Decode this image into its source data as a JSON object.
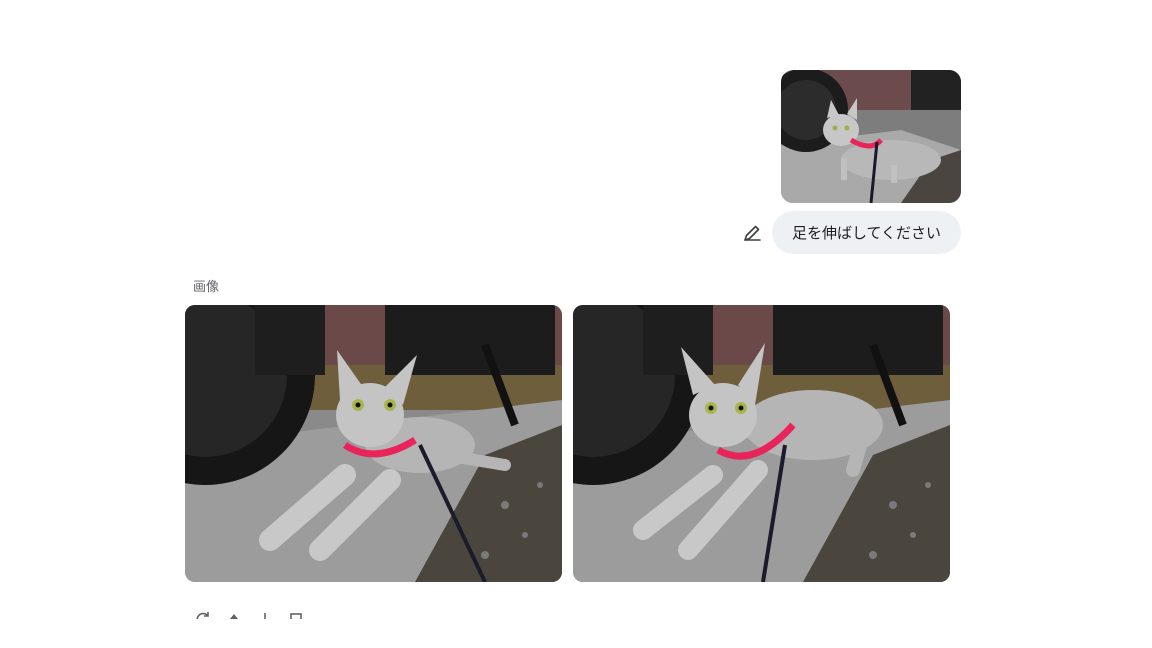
{
  "conversation": {
    "user_message": {
      "text": "足を伸ばしてください",
      "attachment_icon": "cat-photo-thumbnail",
      "edit_icon": "pencil-icon"
    },
    "response": {
      "section_label": "画像",
      "images": [
        {
          "icon": "cat-lying-photo"
        },
        {
          "icon": "cat-stretching-photo"
        }
      ],
      "actions": [
        {
          "icon": "regenerate-icon"
        },
        {
          "icon": "thumbs-up-icon"
        },
        {
          "icon": "thumbs-down-icon"
        },
        {
          "icon": "copy-icon"
        }
      ]
    }
  },
  "colors": {
    "bubble_bg": "#eef1f3",
    "label": "#5f6368",
    "harness": "#e8245a"
  }
}
